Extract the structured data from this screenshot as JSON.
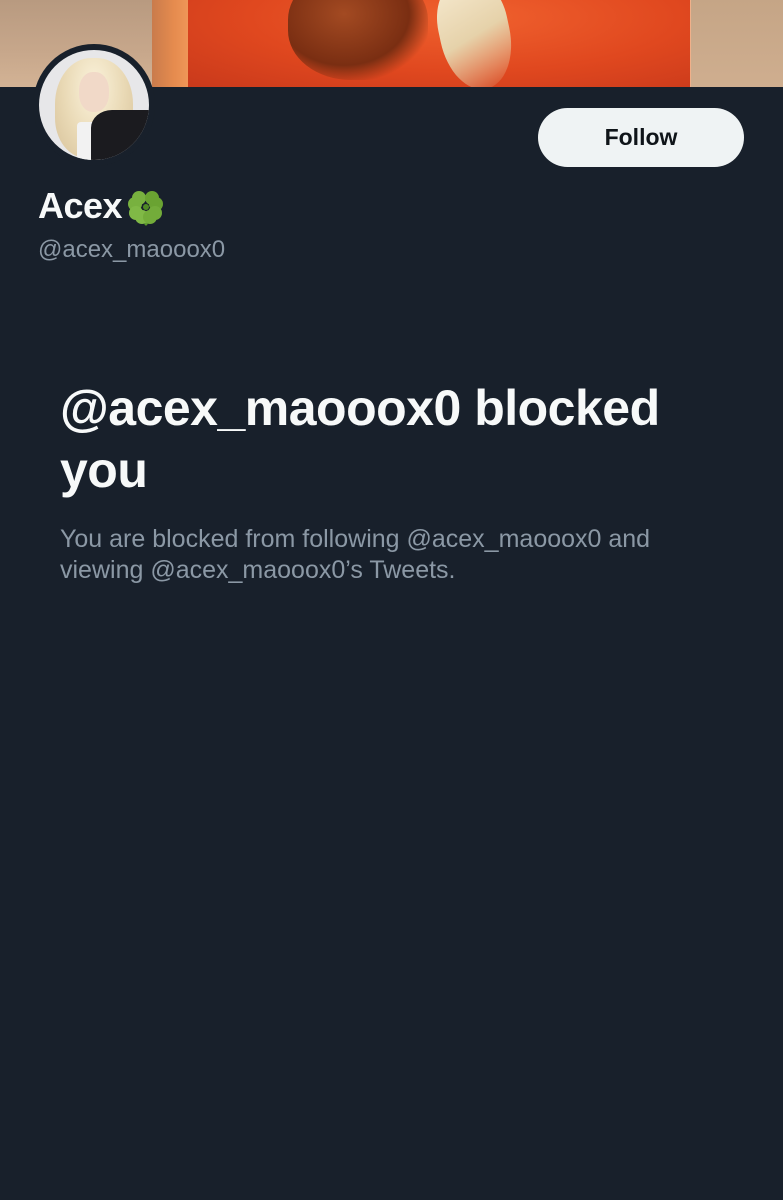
{
  "profile": {
    "display_name": "Acex",
    "name_emoji_icon": "four-leaf-clover-icon",
    "handle": "@acex_maooox0"
  },
  "actions": {
    "follow_label": "Follow"
  },
  "blocked": {
    "title": "@acex_maooox0 blocked you",
    "description": "You are blocked from following @acex_maooox0 and viewing @acex_maooox0’s Tweets."
  },
  "colors": {
    "background": "#18202b",
    "primary_text": "#f7f9f9",
    "secondary_text": "#8b98a5",
    "follow_button_bg": "#eff3f4",
    "follow_button_text": "#0f1419"
  }
}
